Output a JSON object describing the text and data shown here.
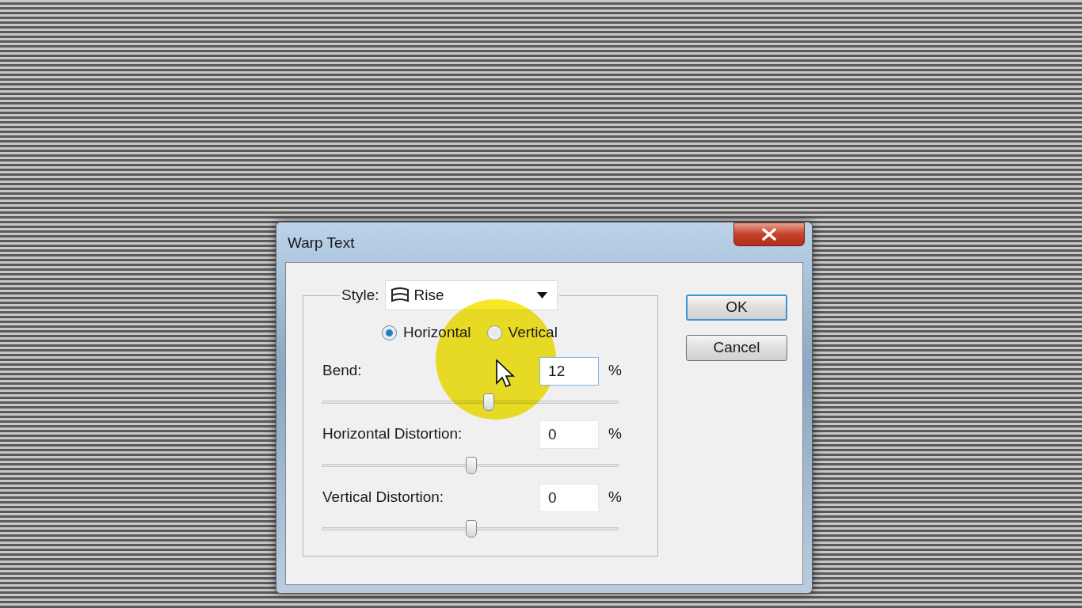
{
  "dialog": {
    "title": "Warp Text",
    "style": {
      "label": "Style:",
      "value": "Rise"
    },
    "orientation": [
      {
        "label": "Horizontal",
        "selected": true
      },
      {
        "label": "Vertical",
        "selected": false
      }
    ],
    "sliders": [
      {
        "label": "Bend:",
        "value": "12",
        "unit": "%",
        "level": 0.56,
        "focused": true
      },
      {
        "label": "Horizontal Distortion:",
        "value": "0",
        "unit": "%",
        "level": 0.5,
        "focused": false
      },
      {
        "label": "Vertical Distortion:",
        "value": "0",
        "unit": "%",
        "level": 0.5,
        "focused": false
      }
    ],
    "buttons": [
      {
        "label": "OK",
        "default": true
      },
      {
        "label": "Cancel",
        "default": false
      }
    ]
  }
}
